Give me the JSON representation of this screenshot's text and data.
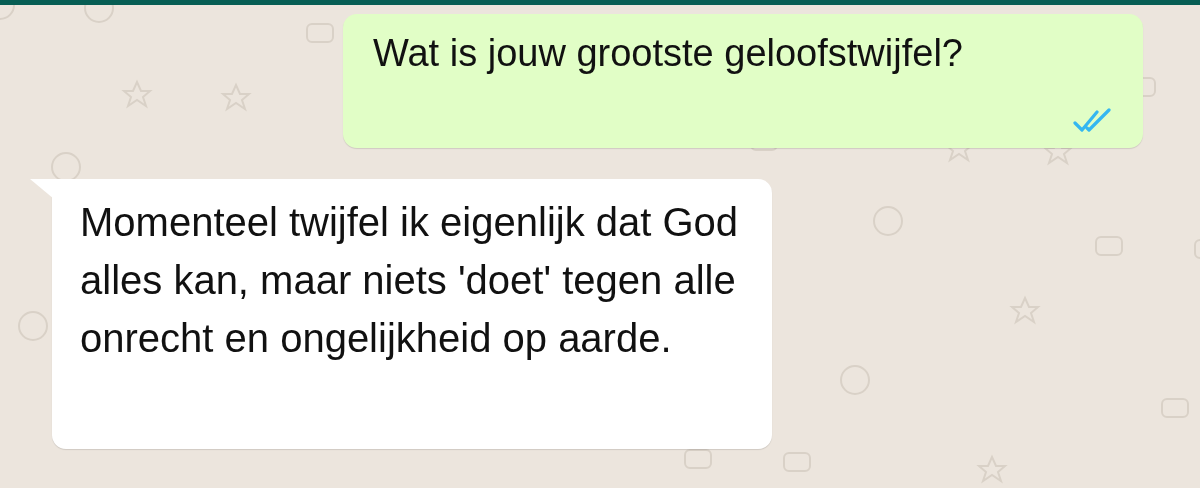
{
  "messages": [
    {
      "kind": "outgoing",
      "text": "Wat is jouw grootste geloofstwijfel?",
      "read": true
    },
    {
      "kind": "incoming",
      "text": "Momenteel twijfel ik eigenlijk dat God\nalles kan, maar niets 'doet' tegen alle\nonrecht en ongelijkheid op aarde."
    }
  ]
}
